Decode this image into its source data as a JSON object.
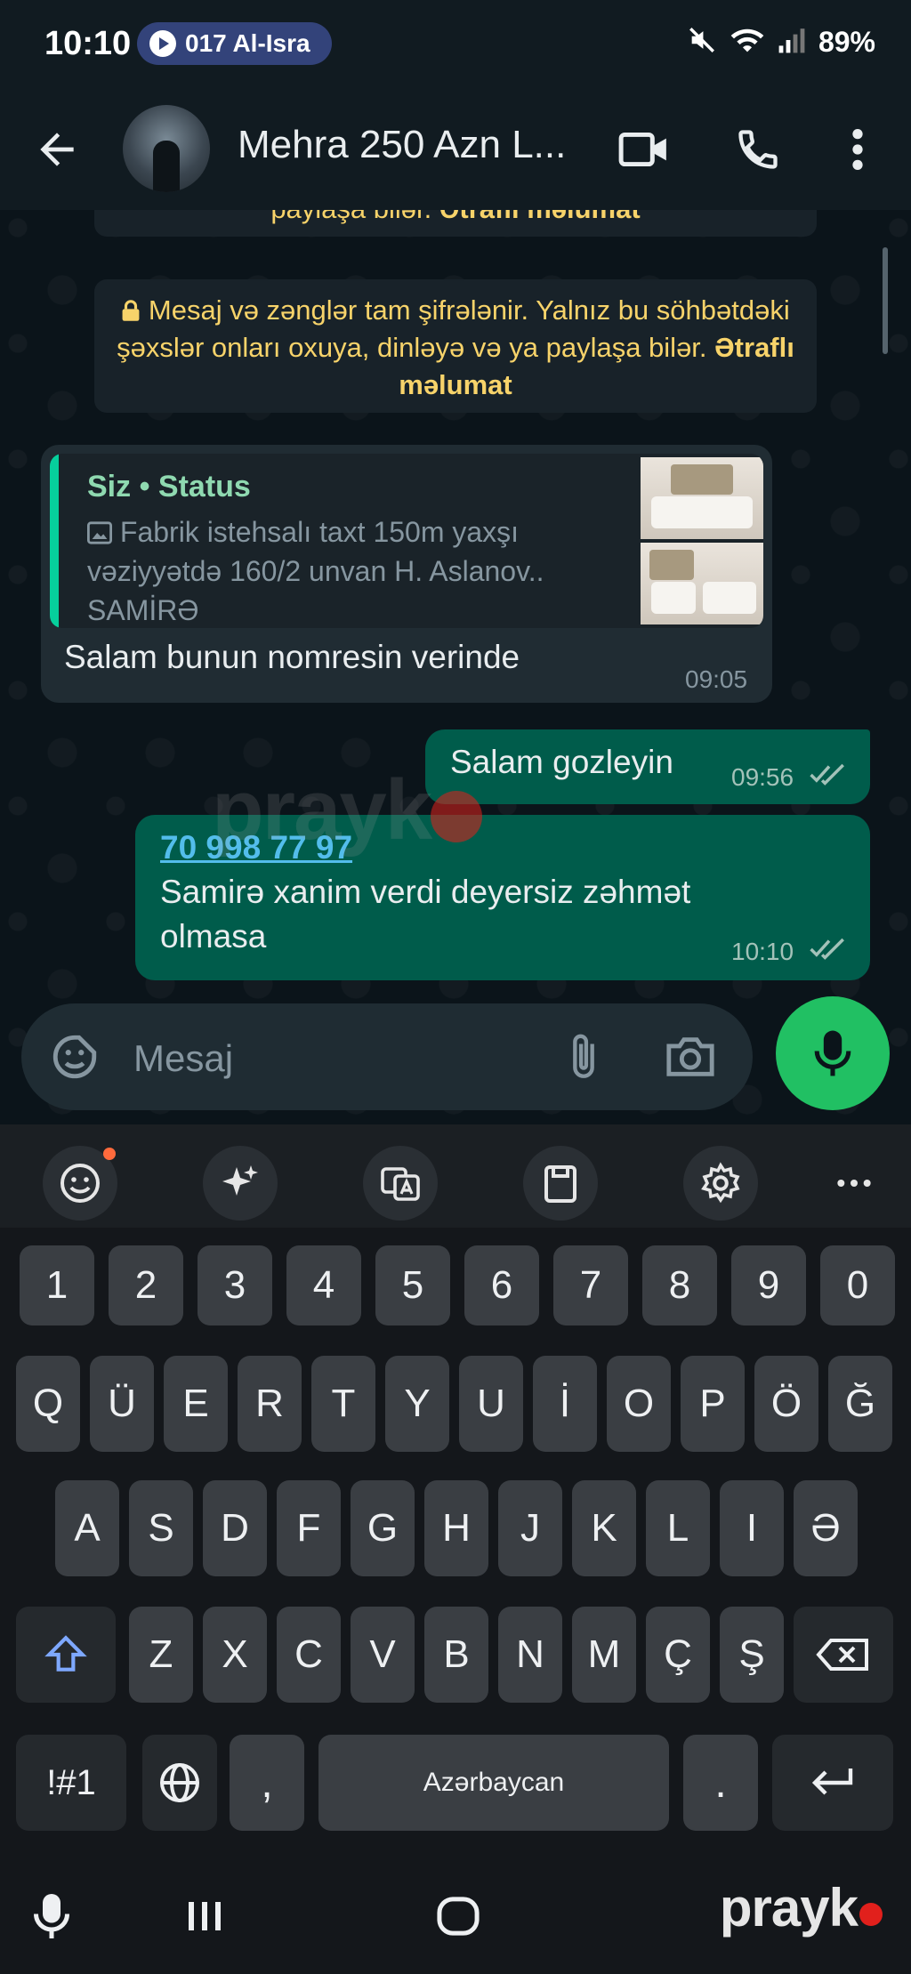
{
  "status_bar": {
    "time": "10:10",
    "media": "017 Al-Isra",
    "battery": "89%"
  },
  "header": {
    "contact_name": "Mehra 250 Azn L..."
  },
  "notices": {
    "top_partial_plain": "paylaşa bilər.",
    "top_partial_bold": "Ətraflı məlumat",
    "encryption_text": "Mesaj və zənglər tam şifrələnir. Yalnız bu söhbətdəki şəxslər onları oxuya, dinləyə və ya paylaşa bilər.",
    "encryption_link": "Ətraflı məlumat"
  },
  "messages": {
    "incoming": {
      "quote_author": "Siz • Status",
      "quote_text": "Fabrik istehsalı taxt 150m yaxşı vəziyyətdə 160/2 unvan H. Aslanov.. SAMİRƏ",
      "text": "Salam bunun nomresin verinde",
      "time": "09:05"
    },
    "outgoing_1": {
      "text": "Salam  gozleyin",
      "time": "09:56"
    },
    "outgoing_2": {
      "phone": "70 998 77 97",
      "text": "Samirə xanim verdi deyersiz zəhmət olmasa",
      "time": "10:10"
    }
  },
  "composer": {
    "placeholder": "Mesaj"
  },
  "keyboard": {
    "row_numbers": [
      "1",
      "2",
      "3",
      "4",
      "5",
      "6",
      "7",
      "8",
      "9",
      "0"
    ],
    "row_1": [
      "Q",
      "Ü",
      "E",
      "R",
      "T",
      "Y",
      "U",
      "İ",
      "O",
      "P",
      "Ö",
      "Ğ"
    ],
    "row_2": [
      "A",
      "S",
      "D",
      "F",
      "G",
      "H",
      "J",
      "K",
      "L",
      "I",
      "Ə"
    ],
    "row_3": [
      "Z",
      "X",
      "C",
      "V",
      "B",
      "N",
      "M",
      "Ç",
      "Ş"
    ],
    "symbols_key": "!#1",
    "comma_key": ",",
    "space_label": "Azərbaycan",
    "period_key": "."
  },
  "watermark": {
    "brand": "prayk"
  },
  "colors": {
    "outgoing_bubble": "#005c4b",
    "incoming_bubble": "#202c33",
    "accent_green": "#21c063",
    "notice_text": "#f7d36a",
    "link": "#53bdeb"
  }
}
